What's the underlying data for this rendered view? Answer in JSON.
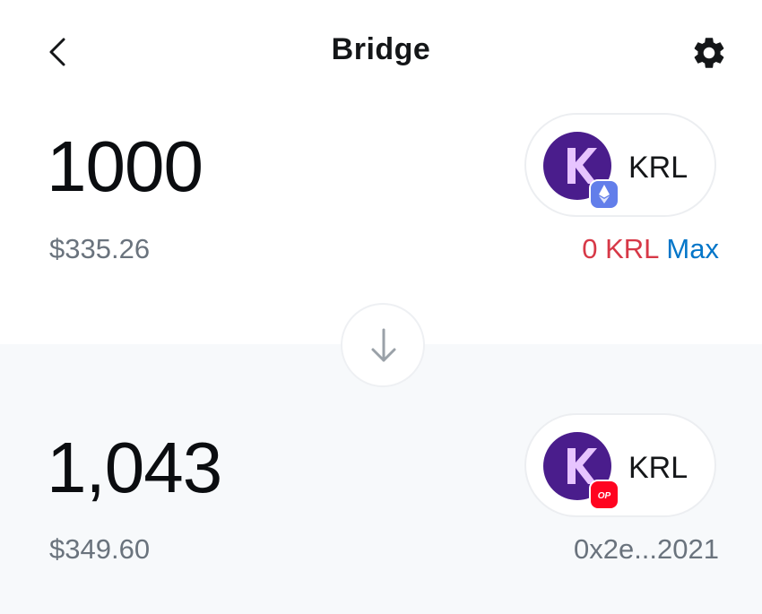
{
  "header": {
    "title": "Bridge"
  },
  "source": {
    "amount": "1000",
    "fiat_value": "$335.26",
    "token_symbol": "KRL",
    "network_icon": "ethereum-icon",
    "balance": "0 KRL",
    "max_label": "Max"
  },
  "destination": {
    "amount": "1,043",
    "fiat_value": "$349.60",
    "token_symbol": "KRL",
    "network_icon": "optimism-icon",
    "network_badge_text": "OP",
    "address": "0x2e...2021"
  },
  "icons": {
    "back": "chevron-left-icon",
    "settings": "gear-icon",
    "switch": "arrow-down-icon",
    "token": "krl-token-icon"
  },
  "colors": {
    "top_background": "#ffffff",
    "bottom_background": "#f7f9fb",
    "balance_red": "#d73847",
    "max_blue": "#0376c9",
    "muted_text": "#6a737d",
    "krl_purple": "#4a1d8c",
    "eth_badge": "#627eea",
    "op_badge": "#ff0420"
  }
}
